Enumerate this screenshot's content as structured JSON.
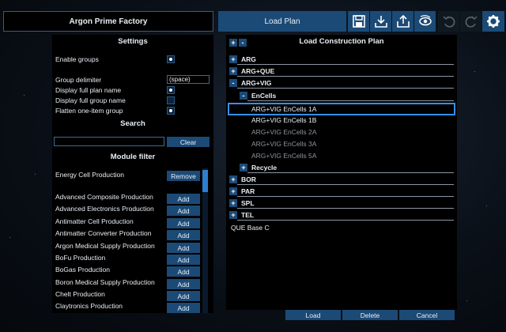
{
  "header": {
    "station_name": "Argon Prime Factory",
    "load_plan_label": "Load Plan"
  },
  "toolbar": {
    "icons": [
      "save-icon",
      "download-icon",
      "share-icon",
      "preview-icon",
      "undo-icon",
      "redo-icon",
      "gear-icon"
    ]
  },
  "settings": {
    "title": "Settings",
    "enable_groups": {
      "label": "Enable groups",
      "checked": true
    },
    "group_delimiter": {
      "label": "Group delimiter",
      "value": "(space)"
    },
    "display_full_plan_name": {
      "label": "Display full plan name",
      "checked": true
    },
    "display_full_group_name": {
      "label": "Display full group name",
      "checked": false
    },
    "flatten_one_item_group": {
      "label": "Flatten one-item group",
      "checked": true
    }
  },
  "search": {
    "title": "Search",
    "value": "",
    "clear_label": "Clear"
  },
  "module_filter": {
    "title": "Module filter",
    "active": [
      {
        "name": "Energy Cell Production",
        "action": "Remove"
      }
    ],
    "available": [
      {
        "name": "Advanced Composite Production",
        "action": "Add"
      },
      {
        "name": "Advanced Electronics Production",
        "action": "Add"
      },
      {
        "name": "Antimatter Cell Production",
        "action": "Add"
      },
      {
        "name": "Antimatter Converter Production",
        "action": "Add"
      },
      {
        "name": "Argon Medical Supply Production",
        "action": "Add"
      },
      {
        "name": "BoFu Production",
        "action": "Add"
      },
      {
        "name": "BoGas Production",
        "action": "Add"
      },
      {
        "name": "Boron Medical Supply Production",
        "action": "Add"
      },
      {
        "name": "Chelt Production",
        "action": "Add"
      },
      {
        "name": "Claytronics Production",
        "action": "Add"
      }
    ]
  },
  "plan": {
    "title": "Load Construction Plan",
    "expand_all": "+",
    "collapse_all": "-",
    "tree": [
      {
        "label": "ARG",
        "toggle": "+"
      },
      {
        "label": "ARG+QUE",
        "toggle": "+"
      },
      {
        "label": "ARG+VIG",
        "toggle": "-"
      },
      {
        "label": "EnCells",
        "toggle": "-"
      },
      {
        "label": "ARG+VIG EnCells 1A"
      },
      {
        "label": "ARG+VIG EnCells 1B"
      },
      {
        "label": "ARG+VIG EnCells 2A"
      },
      {
        "label": "ARG+VIG EnCells 3A"
      },
      {
        "label": "ARG+VIG EnCells 5A"
      },
      {
        "label": "Recycle",
        "toggle": "+"
      },
      {
        "label": "BOR",
        "toggle": "+"
      },
      {
        "label": "PAR",
        "toggle": "+"
      },
      {
        "label": "SPL",
        "toggle": "+"
      },
      {
        "label": "TEL",
        "toggle": "+"
      },
      {
        "label": "QUE Base C"
      }
    ]
  },
  "actions": {
    "load": "Load",
    "delete": "Delete",
    "cancel": "Cancel"
  },
  "colors": {
    "button": "#1c4a76",
    "selection": "#3a8ee6",
    "scroll_thumb": "#2e7ed0",
    "disabled_text": "#8d949c"
  }
}
